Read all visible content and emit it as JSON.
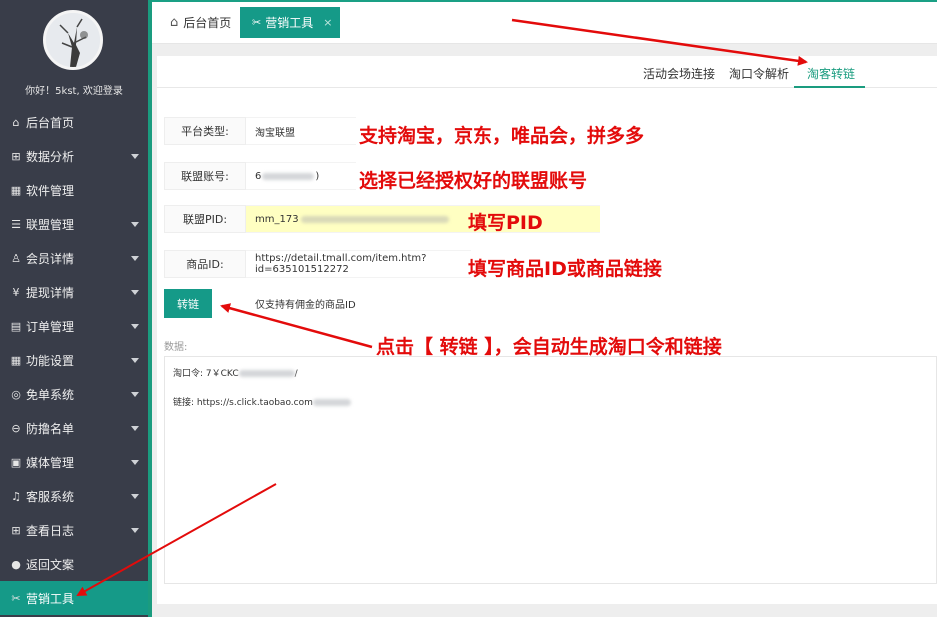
{
  "sidebar": {
    "welcome": "你好！5kst, 欢迎登录",
    "items": [
      {
        "icon": "⌂",
        "label": "后台首页",
        "caret": false
      },
      {
        "icon": "⊞",
        "label": "数据分析",
        "caret": true
      },
      {
        "icon": "▦",
        "label": "软件管理",
        "caret": false
      },
      {
        "icon": "☰",
        "label": "联盟管理",
        "caret": true
      },
      {
        "icon": "♙",
        "label": "会员详情",
        "caret": true
      },
      {
        "icon": "¥",
        "label": "提现详情",
        "caret": true
      },
      {
        "icon": "▤",
        "label": "订单管理",
        "caret": true
      },
      {
        "icon": "▦",
        "label": "功能设置",
        "caret": true
      },
      {
        "icon": "◎",
        "label": "免单系统",
        "caret": true
      },
      {
        "icon": "⊖",
        "label": "防撸名单",
        "caret": true
      },
      {
        "icon": "▣",
        "label": "媒体管理",
        "caret": true
      },
      {
        "icon": "♫",
        "label": "客服系统",
        "caret": true
      },
      {
        "icon": "⊞",
        "label": "查看日志",
        "caret": true
      },
      {
        "icon": "●",
        "label": "返回文案",
        "caret": false
      },
      {
        "icon": "✂",
        "label": "营销工具",
        "caret": false
      }
    ]
  },
  "tabs": {
    "home": "后台首页",
    "active": "营销工具",
    "close": "×"
  },
  "subtabs": [
    "活动会场连接",
    "淘口令解析",
    "淘客转链"
  ],
  "form": {
    "platform_label": "平台类型:",
    "platform_value": "淘宝联盟",
    "account_label": "联盟账号:",
    "account_value_start": "6",
    "account_value_end": ")",
    "pid_label": "联盟PID:",
    "pid_value": "mm_173",
    "product_label": "商品ID:",
    "product_value": "https://detail.tmall.com/item.htm?id=635101512272"
  },
  "convert_button": "转链",
  "hint": "仅支持有佣金的商品ID",
  "data_label": "数据:",
  "result": {
    "line1": "淘口令: 7￥CKC",
    "line1_end": "/",
    "line2": "链接: https://s.click.taobao.com"
  },
  "annotations": {
    "a1": "支持淘宝，京东，唯品会，拼多多",
    "a2": "选择已经授权好的联盟账号",
    "a3": "填写PID",
    "a4": "填写商品ID或商品链接",
    "a5": "点击【 转链 】，会自动生成淘口令和链接"
  },
  "colors": {
    "sidebar_bg": "#393d49",
    "accent": "#159a88",
    "annotation": "#e30b0b"
  }
}
